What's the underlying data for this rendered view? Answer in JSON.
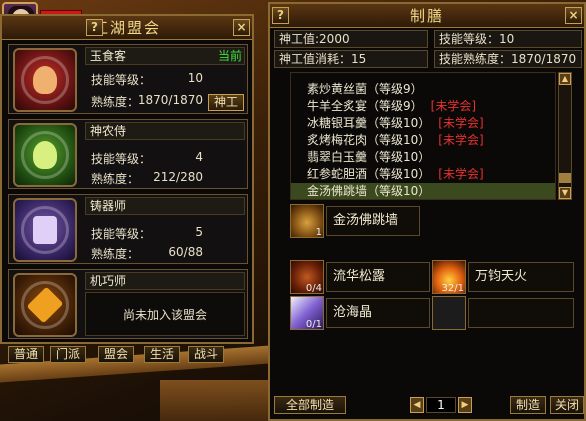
{
  "guild_panel": {
    "title": "江湖盟会",
    "help_label": "?",
    "close_label": "×",
    "skill_label": "技能等级：",
    "proficiency_label": "熟练度：",
    "cards": [
      {
        "name": "玉食客",
        "badge": "当前",
        "level": "10",
        "proficiency": "1870/1870",
        "button": "神工"
      },
      {
        "name": "神农侍",
        "level": "4",
        "proficiency": "212/280"
      },
      {
        "name": "铸器师",
        "level": "5",
        "proficiency": "60/88"
      },
      {
        "name": "机巧师",
        "message": "尚未加入该盟会"
      }
    ],
    "tabs": [
      "普通",
      "门派",
      "盟会",
      "生活",
      "战斗"
    ]
  },
  "cook_panel": {
    "title": "制膳",
    "help_label": "?",
    "close_label": "×",
    "stats": {
      "shengong": "神工值:2000",
      "skill_level": "技能等级：10",
      "shengong_cost": "神工值消耗：15",
      "proficiency": "技能熟练度：1870/1870"
    },
    "recipes": [
      {
        "name": "素炒黄丝菌（等级9）",
        "warn": ""
      },
      {
        "name": "牛羊全炙宴（等级9）",
        "warn": "[未学会]"
      },
      {
        "name": "冰糖银耳羹（等级10）",
        "warn": "[未学会]"
      },
      {
        "name": "炙烤梅花肉（等级10）",
        "warn": "[未学会]"
      },
      {
        "name": "翡翠白玉羹（等级10）",
        "warn": ""
      },
      {
        "name": "红参蛇胆酒（等级10）",
        "warn": "[未学会]"
      },
      {
        "name": "金汤佛跳墙（等级10）",
        "warn": ""
      }
    ],
    "selected_recipe": "金汤佛跳墙（等级10）",
    "product": {
      "name": "金汤佛跳墙",
      "count": "1"
    },
    "materials": [
      {
        "name": "流华松露",
        "count": "0/4",
        "icon": "truffle-icon"
      },
      {
        "name": "万钧天火",
        "count": "32/1",
        "icon": "fire-icon"
      },
      {
        "name": "沧海晶",
        "count": "0/1",
        "icon": "crystal-icon"
      },
      {
        "name": "",
        "count": "",
        "icon": "empty-slot"
      }
    ],
    "make_all_label": "全部制造",
    "page": "1",
    "make_label": "制造",
    "close_button_label": "关闭"
  }
}
